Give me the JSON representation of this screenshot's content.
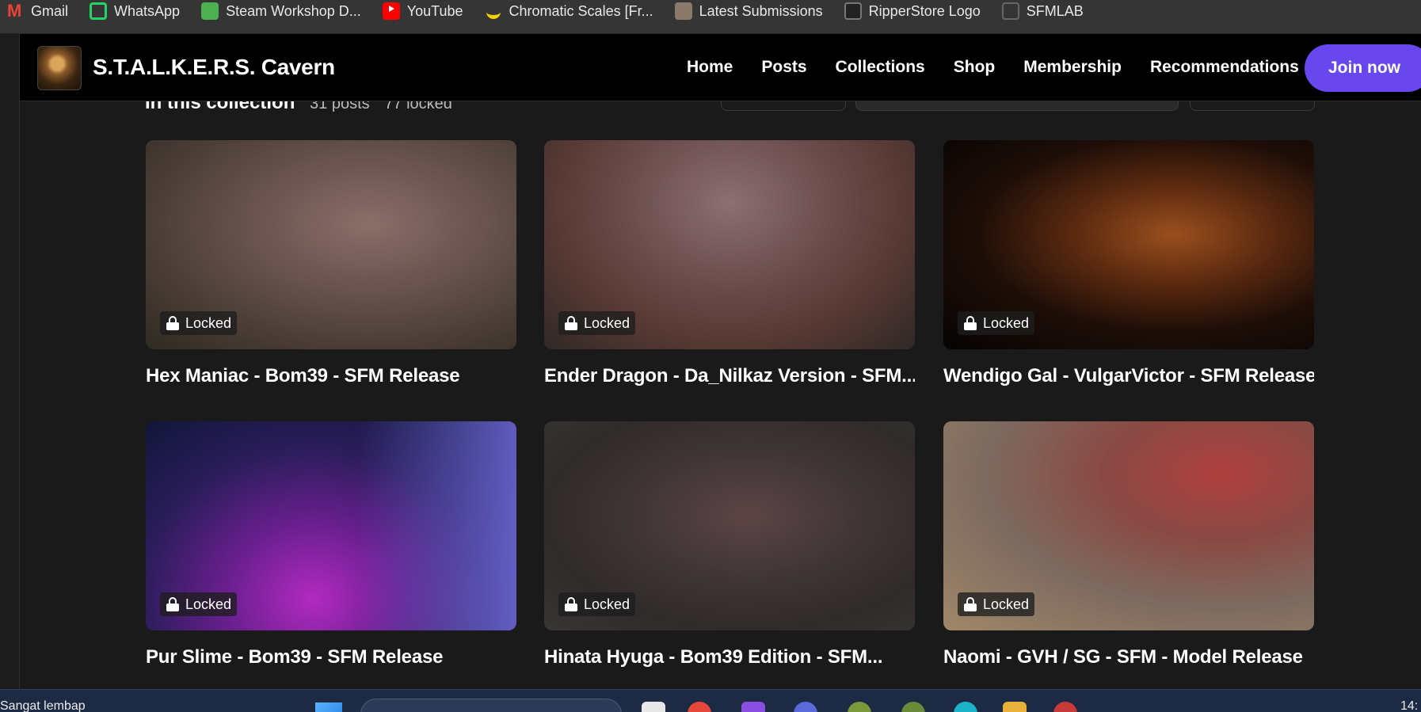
{
  "bookmarks": [
    {
      "label": "Gmail",
      "icon": "gmail-icon"
    },
    {
      "label": "WhatsApp",
      "icon": "whatsapp-icon"
    },
    {
      "label": "Steam Workshop D...",
      "icon": "steam-icon"
    },
    {
      "label": "YouTube",
      "icon": "youtube-icon"
    },
    {
      "label": "Chromatic Scales [Fr...",
      "icon": "banana-icon"
    },
    {
      "label": "Latest Submissions",
      "icon": "palette-icon"
    },
    {
      "label": "RipperStore Logo",
      "icon": "ripperstore-icon"
    },
    {
      "label": "SFMLAB",
      "icon": "sfmlab-icon"
    }
  ],
  "site": {
    "title": "S.T.A.L.K.E.R.S. Cavern",
    "nav": [
      "Home",
      "Posts",
      "Collections",
      "Shop",
      "Membership",
      "Recommendations"
    ],
    "join_label": "Join now",
    "accent": "#6848ee"
  },
  "collection": {
    "heading": "In this collection",
    "posts_count": "31 posts",
    "locked_count": "77 locked"
  },
  "posts": [
    {
      "title": "Hex Maniac - Bom39 - SFM Release",
      "badge": "Locked"
    },
    {
      "title": "Ender Dragon - Da_Nilkaz Version - SFM...",
      "badge": "Locked"
    },
    {
      "title": "Wendigo Gal - VulgarVictor - SFM Release",
      "badge": "Locked"
    },
    {
      "title": "Pur Slime - Bom39 - SFM Release",
      "badge": "Locked"
    },
    {
      "title": "Hinata Hyuga - Bom39 Edition - SFM...",
      "badge": "Locked"
    },
    {
      "title": "Naomi - GVH / SG - SFM - Model Release",
      "badge": "Locked"
    }
  ],
  "taskbar": {
    "weather": "Sangat lembap",
    "clock": "14:"
  }
}
